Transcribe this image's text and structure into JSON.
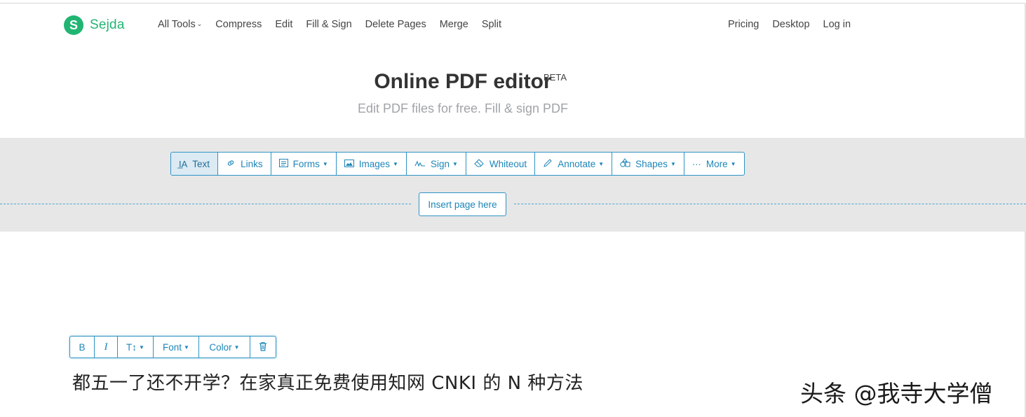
{
  "header": {
    "logo_letter": "S",
    "logo_text": "Sejda",
    "nav_left": [
      {
        "label": "All Tools",
        "caret": "⌄"
      },
      {
        "label": "Compress"
      },
      {
        "label": "Edit"
      },
      {
        "label": "Fill & Sign"
      },
      {
        "label": "Delete Pages"
      },
      {
        "label": "Merge"
      },
      {
        "label": "Split"
      }
    ],
    "nav_right": [
      {
        "label": "Pricing"
      },
      {
        "label": "Desktop"
      },
      {
        "label": "Log in"
      }
    ]
  },
  "hero": {
    "title": "Online PDF editor",
    "badge": "BETA",
    "subtitle": "Edit PDF files for free. Fill & sign PDF"
  },
  "toolbar": {
    "tools": [
      {
        "label": "Text",
        "icon": "text-cursor-icon",
        "glyph": "I̲A",
        "active": true
      },
      {
        "label": "Links",
        "icon": "link-icon",
        "glyph": "🔗"
      },
      {
        "label": "Forms",
        "icon": "form-icon",
        "glyph": "☰",
        "dropdown": true
      },
      {
        "label": "Images",
        "icon": "image-icon",
        "glyph": "▭",
        "dropdown": true
      },
      {
        "label": "Sign",
        "icon": "signature-icon",
        "glyph": "∿",
        "dropdown": true
      },
      {
        "label": "Whiteout",
        "icon": "eraser-icon",
        "glyph": "◇"
      },
      {
        "label": "Annotate",
        "icon": "pen-icon",
        "glyph": "✎",
        "dropdown": true
      },
      {
        "label": "Shapes",
        "icon": "shapes-icon",
        "glyph": "♧",
        "dropdown": true
      },
      {
        "label": "More",
        "icon": "ellipsis-icon",
        "glyph": "···",
        "dropdown": true
      }
    ],
    "insert_page": "Insert page here"
  },
  "format_bar": {
    "bold": "B",
    "italic": "I",
    "size_glyph": "T↕",
    "font": "Font",
    "color": "Color",
    "delete_icon": "trash-icon",
    "delete_glyph": "🗑"
  },
  "document": {
    "text": "都五一了还不开学？在家真正免费使用知网 CNKI 的 N 种方法"
  },
  "watermark": "头条 @我寺大学僧",
  "colors": {
    "brand": "#21b573",
    "accent": "#2e93c4",
    "band": "#e7e7e7"
  }
}
